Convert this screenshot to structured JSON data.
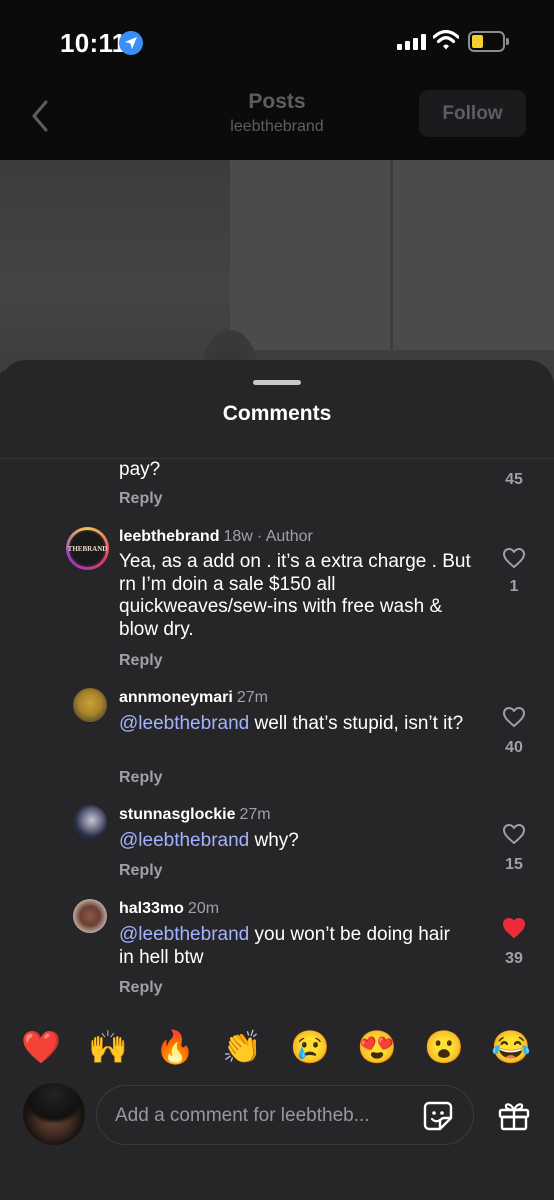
{
  "status_bar": {
    "time": "10:11"
  },
  "header": {
    "title": "Posts",
    "subtitle": "leebthebrand",
    "follow_label": "Follow"
  },
  "sheet": {
    "title": "Comments"
  },
  "comments": [
    {
      "text_tail": "pay?",
      "reply": "Reply",
      "likes": "45"
    },
    {
      "username": "leebthebrand",
      "time": "18w",
      "badge": "· Author",
      "text": "Yea,  as a add on . it’s a extra charge . But rn I’m doin a sale $150 all quickweaves/sew-ins with free wash & blow dry.",
      "reply": "Reply",
      "likes": "1",
      "avatar_label": "THEBRAND"
    },
    {
      "username": "annmoneymari",
      "time": "27m",
      "mention": "@leebthebrand",
      "text": " well that’s stupid, isn’t it?",
      "reply": "Reply",
      "likes": "40"
    },
    {
      "username": "stunnasglockie",
      "time": "27m",
      "mention": "@leebthebrand",
      "text": " why?",
      "reply": "Reply",
      "likes": "15"
    },
    {
      "username": "hal33mo",
      "time": "20m",
      "mention": "@leebthebrand",
      "text": " you won’t be doing hair in hell btw",
      "reply": "Reply",
      "likes": "39",
      "liked": true
    }
  ],
  "reactions": [
    "❤️",
    "🙌",
    "🔥",
    "👏",
    "😢",
    "😍",
    "😮",
    "😂"
  ],
  "composer": {
    "placeholder": "Add a comment for leebtheb..."
  },
  "colors": {
    "mention": "#a4b2ff",
    "liked_heart": "#ee2b3b",
    "sheet_bg": "#262628"
  },
  "icons": [
    "location-arrow-icon",
    "signal-icon",
    "wifi-icon",
    "battery-icon",
    "back-chevron-icon",
    "heart-icon",
    "sticker-icon",
    "gift-icon"
  ]
}
